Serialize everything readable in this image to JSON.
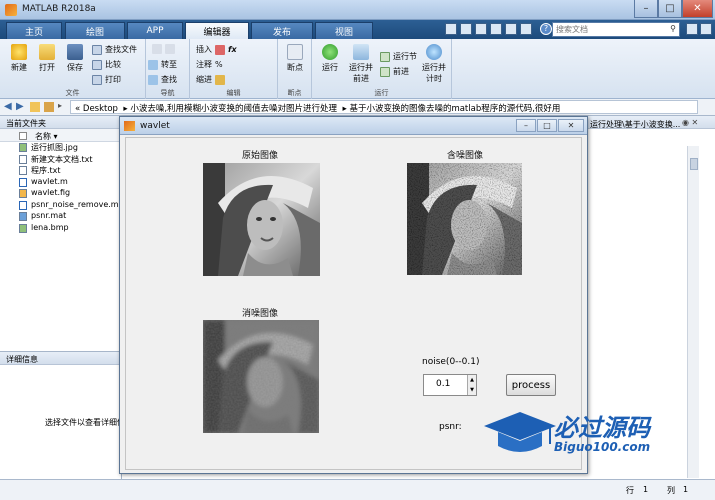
{
  "window": {
    "title": "MATLAB R2018a"
  },
  "tabs": [
    {
      "label": "主页"
    },
    {
      "label": "绘图"
    },
    {
      "label": "APP"
    },
    {
      "label": "编辑器"
    },
    {
      "label": "发布"
    },
    {
      "label": "视图"
    }
  ],
  "search": {
    "placeholder": "搜索文档"
  },
  "toolstrip": {
    "file": {
      "group_label": "文件",
      "new": "新建",
      "open": "打开",
      "save": "保存",
      "find_files": "查找文件",
      "compare": "比较",
      "print": "打印"
    },
    "navigate": {
      "group_label": "导航",
      "goto": "转至",
      "find": "查找"
    },
    "edit": {
      "group_label": "编辑",
      "insert": "插入",
      "fx": "fx",
      "comment": "注释",
      "percent": "%",
      "indent": "缩进"
    },
    "breakpoints": {
      "group_label": "断点",
      "breakpoint": "断点"
    },
    "run": {
      "group_label": "运行",
      "run": "运行",
      "run_advance": "运行并前进",
      "run_section": "运行节",
      "advance": "前进",
      "run_time": "运行并计时"
    }
  },
  "address": {
    "path": [
      "« Desktop",
      "小波去噪,利用模糊小波变换的阈值去噪对图片进行处理",
      "基于小波变换的图像去噪的matlab程序的源代码,很好用"
    ]
  },
  "current_folder": {
    "title": "当前文件夹",
    "column_name": "名称",
    "files": [
      {
        "name": "运行抓图.jpg",
        "type": "img"
      },
      {
        "name": "新建文本文档.txt",
        "type": "txt"
      },
      {
        "name": "程序.txt",
        "type": "txt"
      },
      {
        "name": "wavlet.m",
        "type": "m"
      },
      {
        "name": "wavlet.fig",
        "type": "fig"
      },
      {
        "name": "psnr_noise_remove.m",
        "type": "m"
      },
      {
        "name": "psnr.mat",
        "type": "mat"
      },
      {
        "name": "lena.bmp",
        "type": "img"
      }
    ]
  },
  "details": {
    "title": "详细信息",
    "hint": "选择文件以查看详细信息"
  },
  "command_window_header": "运行处理\\基于小波变换...",
  "figure": {
    "title": "wavlet",
    "original_caption": "原始图像",
    "noisy_caption": "含噪图像",
    "denoised_caption": "消噪图像",
    "noise_label": "noise(0--0.1)",
    "noise_value": "0.1",
    "process_button": "process",
    "psnr_label": "psnr:"
  },
  "statusbar": {
    "row_label": "行",
    "row_value": "1",
    "col_label": "列",
    "col_value": "1"
  },
  "watermark": {
    "text": "必过源码",
    "url": "Biguo100.com"
  },
  "colors": {
    "accent": "#1d4a7b",
    "watermark": "#1d5fb4"
  }
}
